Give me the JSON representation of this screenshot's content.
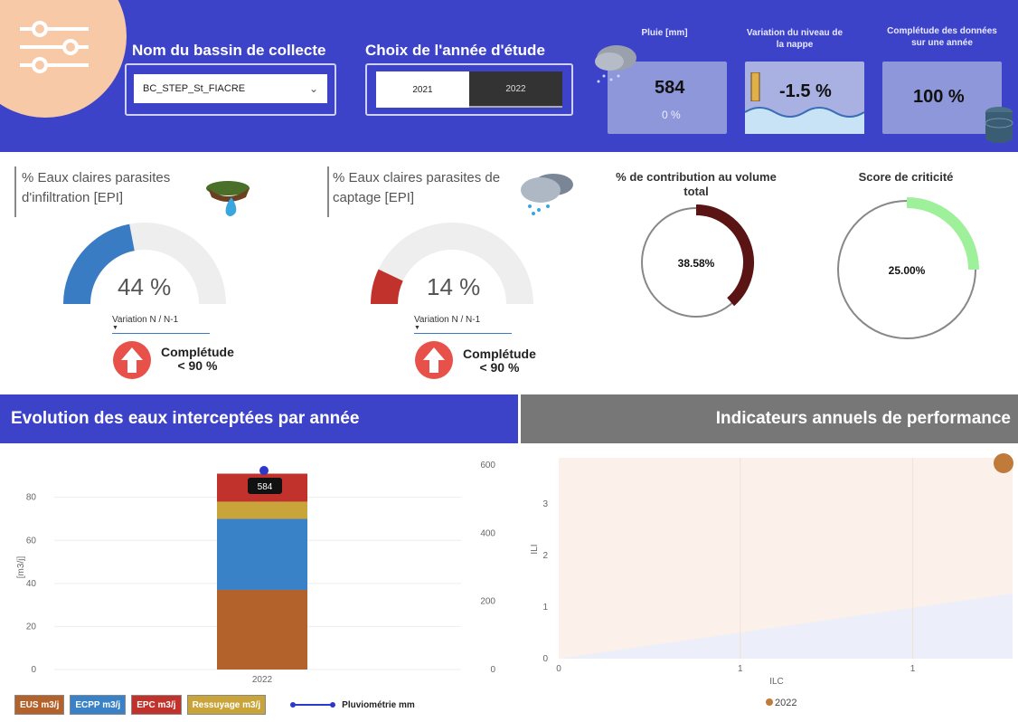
{
  "header": {
    "basin_label": "Nom du bassin de collecte",
    "basin_value": "BC_STEP_St_FIACRE",
    "year_label": "Choix de l'année d'étude",
    "year_options": [
      "2021",
      "2022"
    ],
    "year_selected": "2022",
    "rain_title": "Pluie [mm]",
    "rain_value": "584",
    "rain_sub": "0 %",
    "nappe_title": "Variation du niveau de la nappe",
    "nappe_value": "-1.5 %",
    "completude_title": "Complétude des données sur une année",
    "completude_value": "100 %"
  },
  "gauges": {
    "infiltration": {
      "title": "% Eaux claires parasites d'infiltration [EPI]",
      "value": "44 %",
      "fraction": 0.44,
      "variation_label": "Variation N / N-1",
      "completude": "Complétude",
      "completude_sub": "< 90 %",
      "color": "#3a7cc4"
    },
    "captage": {
      "title": "% Eaux claires parasites de captage [EPI]",
      "value": "14 %",
      "fraction": 0.14,
      "variation_label": "Variation N / N-1",
      "completude": "Complétude",
      "completude_sub": "< 90 %",
      "color": "#c0322b"
    }
  },
  "donuts": {
    "contribution": {
      "title": "% de contribution au volume total",
      "value": "38.58%",
      "fraction": 0.3858,
      "color": "#5a1414"
    },
    "criticite": {
      "title": "Score de criticité",
      "value": "25.00%",
      "fraction": 0.25,
      "color": "#9ef09a"
    }
  },
  "banners": {
    "left": "Evolution des eaux interceptées par année",
    "right": "Indicateurs annuels de performance"
  },
  "chart_data": [
    {
      "type": "bar",
      "categories": [
        "2022"
      ],
      "series": [
        {
          "name": "EUS m3/j",
          "values": [
            37
          ],
          "color": "#b2622a"
        },
        {
          "name": "ECPP m3/j",
          "values": [
            33
          ],
          "color": "#3a82c8"
        },
        {
          "name": "Ressuyage m3/j",
          "values": [
            8
          ],
          "color": "#c9a43a"
        },
        {
          "name": "EPC m3/j",
          "values": [
            13
          ],
          "color": "#c0322b"
        },
        {
          "name": "Pluviométrie mm",
          "values": [
            584
          ],
          "color": "#2b38c9",
          "axis": "right"
        }
      ],
      "ylabel": "[m3/j]",
      "ylim": [
        0,
        95
      ],
      "yticks": [
        "0",
        "20",
        "40",
        "60",
        "80"
      ],
      "y2lim": [
        0,
        600
      ],
      "y2ticks": [
        "0",
        "200",
        "400",
        "600"
      ],
      "data_label": "584"
    },
    {
      "type": "scatter",
      "series": [
        {
          "name": "2022",
          "x": [
            1.18
          ],
          "y": [
            3.9
          ],
          "color": "#c07a3a"
        }
      ],
      "xlabel": "ILC",
      "ylabel": "ILI",
      "xticks": [
        "0",
        "1",
        "1"
      ],
      "yticks": [
        "0",
        "1",
        "2",
        "3"
      ],
      "ylim": [
        0,
        3.9
      ]
    }
  ]
}
